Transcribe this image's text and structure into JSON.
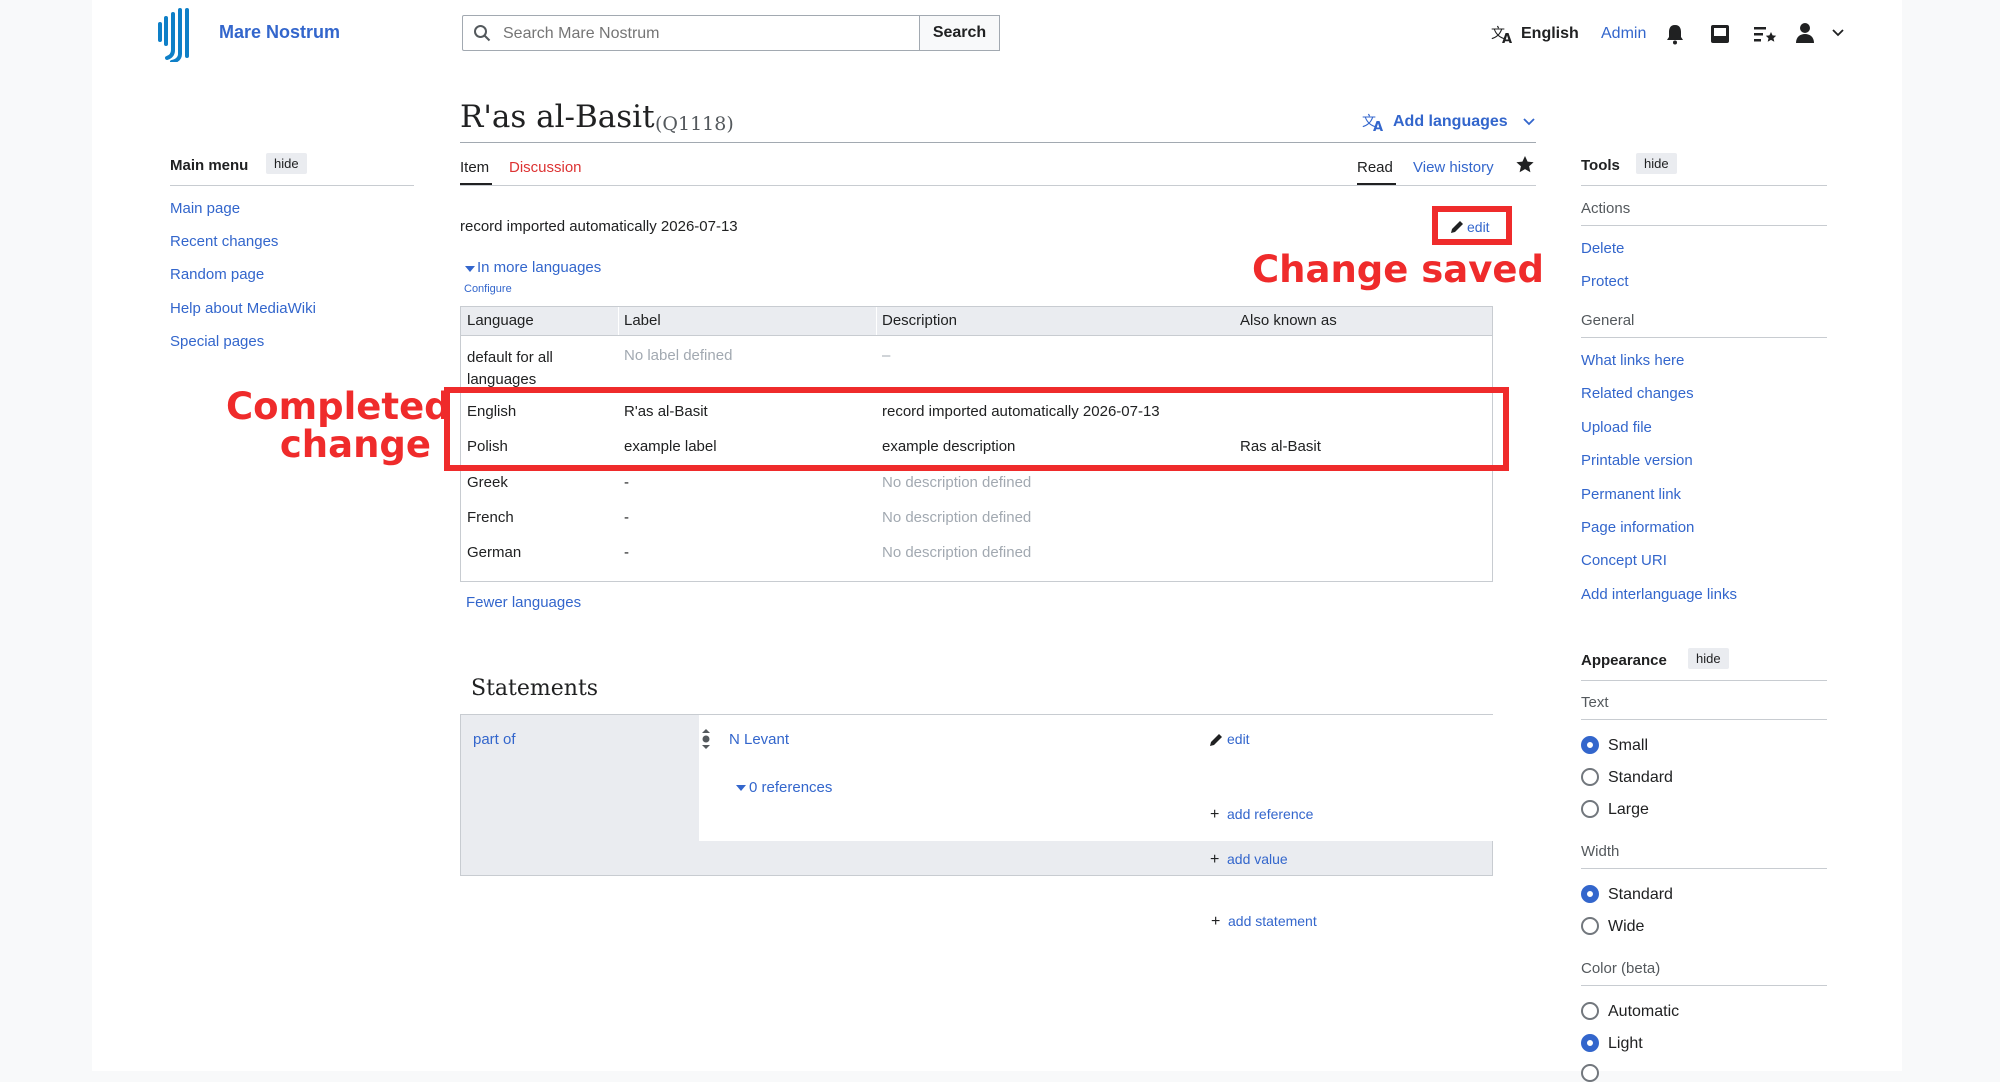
{
  "header": {
    "site_name": "Mare Nostrum",
    "search_placeholder": "Search Mare Nostrum",
    "search_button": "Search",
    "language": "English",
    "user": "Admin"
  },
  "main_menu": {
    "title": "Main menu",
    "hide": "hide",
    "items": [
      "Main page",
      "Recent changes",
      "Random page",
      "Help about MediaWiki",
      "Special pages"
    ]
  },
  "page": {
    "title": "R'as al-Basit",
    "qid": "(Q1118)",
    "add_languages": "Add languages",
    "tabs": {
      "item": "Item",
      "discussion": "Discussion",
      "read": "Read",
      "view_history": "View history"
    },
    "description": "record imported automatically 2026-07-13",
    "edit": "edit",
    "in_more_languages": "In more languages",
    "configure": "Configure",
    "fewer_languages": "Fewer languages"
  },
  "lang_table": {
    "headers": [
      "Language",
      "Label",
      "Description",
      "Also known as"
    ],
    "rows": [
      {
        "language": "default for all languages",
        "label": "No label defined",
        "description": "–",
        "aliases": ""
      },
      {
        "language": "English",
        "label": "R'as al-Basit",
        "description": "record imported automatically 2026-07-13",
        "aliases": ""
      },
      {
        "language": "Polish",
        "label": "example label",
        "description": "example description",
        "aliases": "Ras al-Basit"
      },
      {
        "language": "Greek",
        "label": "-",
        "description": "No description defined",
        "aliases": ""
      },
      {
        "language": "French",
        "label": "-",
        "description": "No description defined",
        "aliases": ""
      },
      {
        "language": "German",
        "label": "-",
        "description": "No description defined",
        "aliases": ""
      }
    ]
  },
  "statements": {
    "heading": "Statements",
    "property": "part of",
    "value": "N Levant",
    "edit": "edit",
    "references": "0 references",
    "add_reference": "add reference",
    "add_value": "add value",
    "add_statement": "add statement"
  },
  "tools": {
    "title": "Tools",
    "hide": "hide",
    "actions_label": "Actions",
    "actions": [
      "Delete",
      "Protect"
    ],
    "general_label": "General",
    "general": [
      "What links here",
      "Related changes",
      "Upload file",
      "Printable version",
      "Permanent link",
      "Page information",
      "Concept URI",
      "Add interlanguage links"
    ]
  },
  "appearance": {
    "title": "Appearance",
    "hide": "hide",
    "text_label": "Text",
    "text_options": [
      "Small",
      "Standard",
      "Large"
    ],
    "text_selected": "Small",
    "width_label": "Width",
    "width_options": [
      "Standard",
      "Wide"
    ],
    "width_selected": "Standard",
    "color_label": "Color (beta)",
    "color_options": [
      "Automatic",
      "Light"
    ],
    "color_selected": "Light"
  },
  "annotations": {
    "change_saved": "Change saved",
    "completed_change_line1": "Completed",
    "completed_change_line2": "change"
  },
  "colors": {
    "link": "#3366cc",
    "annotation": "#ef2b2b",
    "text": "#202122"
  }
}
